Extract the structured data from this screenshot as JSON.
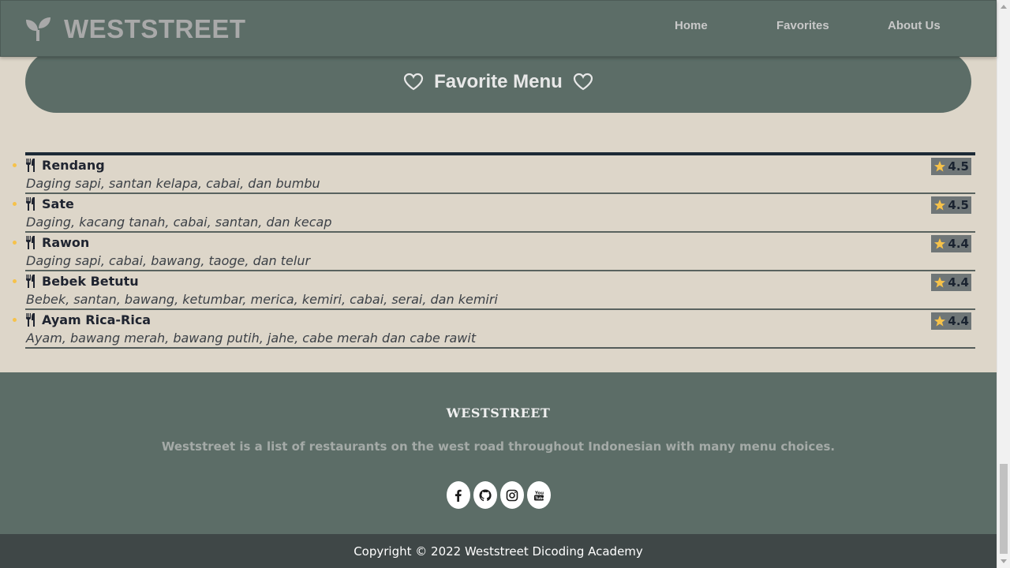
{
  "header": {
    "brand": "WESTSTREET",
    "logo_icon": "leaf-icon",
    "nav": [
      {
        "label": "Home"
      },
      {
        "label": "Favorites"
      },
      {
        "label": "About Us"
      }
    ]
  },
  "hero": {
    "title": "Favorite Menu",
    "icon": "heart-icon"
  },
  "menu": {
    "items": [
      {
        "name": "Rendang",
        "desc": "Daging sapi, santan kelapa, cabai, dan bumbu",
        "rating": "4.5"
      },
      {
        "name": "Sate",
        "desc": "Daging, kacang tanah, cabai, santan, dan kecap",
        "rating": "4.5"
      },
      {
        "name": "Rawon",
        "desc": "Daging sapi, cabai, bawang, taoge, dan telur",
        "rating": "4.4"
      },
      {
        "name": "Bebek Betutu",
        "desc": "Bebek, santan, bawang, ketumbar, merica, kemiri, cabai, serai, dan kemiri",
        "rating": "4.4"
      },
      {
        "name": "Ayam Rica-Rica",
        "desc": "Ayam, bawang merah, bawang putih, jahe, cabe merah dan cabe rawit",
        "rating": "4.4"
      }
    ]
  },
  "footer": {
    "title": "WESTSTREET",
    "description": "Weststreet is a list of restaurants on the west road throughout Indonesian with many menu choices.",
    "socials": [
      "facebook-icon",
      "github-icon",
      "instagram-icon",
      "youtube-icon"
    ],
    "copyright": "Copyright © 2022 Weststreet Dicoding Academy"
  },
  "colors": {
    "header_bg": "#5c6d67",
    "page_bg": "#ddd6c9",
    "accent_star": "#f6c24a",
    "copyright_bg": "#3f4747"
  }
}
